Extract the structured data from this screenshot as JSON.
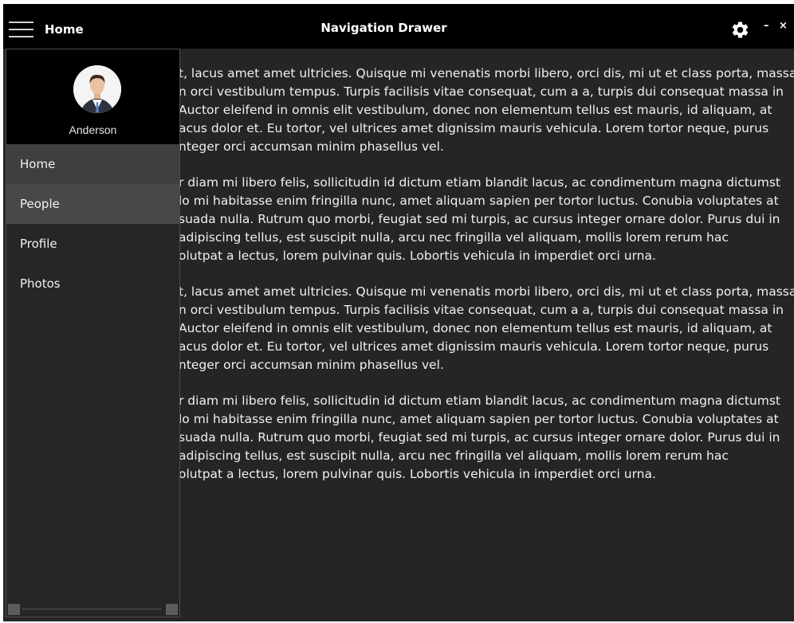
{
  "titlebar": {
    "page_label": "Home",
    "title": "Navigation Drawer",
    "minimize": "–",
    "close": "×",
    "icons": {
      "menu": "hamburger-icon",
      "settings": "gear-icon"
    }
  },
  "drawer": {
    "user_name": "Anderson",
    "items": [
      {
        "label": "Home"
      },
      {
        "label": "People"
      },
      {
        "label": "Profile"
      },
      {
        "label": "Photos"
      }
    ]
  },
  "content": {
    "paragraphs": [
      [
        "t, lacus amet amet ultricies. Quisque mi venenatis morbi libero, orci dis, mi ut et class porta, massa",
        "n orci vestibulum tempus. Turpis facilisis vitae consequat, cum a a, turpis dui consequat massa in",
        "Auctor eleifend in omnis elit vestibulum, donec non elementum tellus est mauris, id aliquam, at",
        "acus dolor et. Eu tortor, vel ultrices amet dignissim mauris vehicula. Lorem tortor neque, purus",
        "nteger orci accumsan minim phasellus vel."
      ],
      [
        "r diam mi libero felis, sollicitudin id dictum etiam blandit lacus, ac condimentum magna dictumst",
        "lo mi habitasse enim fringilla nunc, amet aliquam sapien per tortor luctus. Conubia voluptates at",
        "suada nulla. Rutrum quo morbi, feugiat sed mi turpis, ac cursus integer ornare dolor. Purus dui in",
        "adipiscing tellus, est suscipit nulla, arcu nec fringilla vel aliquam, mollis lorem rerum hac",
        "olutpat a lectus, lorem pulvinar quis. Lobortis vehicula in imperdiet orci urna."
      ],
      [
        "t, lacus amet amet ultricies. Quisque mi venenatis morbi libero, orci dis, mi ut et class porta, massa",
        "n orci vestibulum tempus. Turpis facilisis vitae consequat, cum a a, turpis dui consequat massa in",
        "Auctor eleifend in omnis elit vestibulum, donec non elementum tellus est mauris, id aliquam, at",
        "acus dolor et. Eu tortor, vel ultrices amet dignissim mauris vehicula. Lorem tortor neque, purus",
        "nteger orci accumsan minim phasellus vel."
      ],
      [
        "r diam mi libero felis, sollicitudin id dictum etiam blandit lacus, ac condimentum magna dictumst",
        "lo mi habitasse enim fringilla nunc, amet aliquam sapien per tortor luctus. Conubia voluptates at",
        "suada nulla. Rutrum quo morbi, feugiat sed mi turpis, ac cursus integer ornare dolor. Purus dui in",
        "adipiscing tellus, est suscipit nulla, arcu nec fringilla vel aliquam, mollis lorem rerum hac",
        "olutpat a lectus, lorem pulvinar quis. Lobortis vehicula in imperdiet orci urna."
      ]
    ]
  },
  "colors": {
    "titlebar_bg": "#000000",
    "content_bg": "#252525",
    "drawer_bg": "#262626",
    "item_active_bg": "#3f3f3f",
    "item_hover_bg": "#484848"
  }
}
